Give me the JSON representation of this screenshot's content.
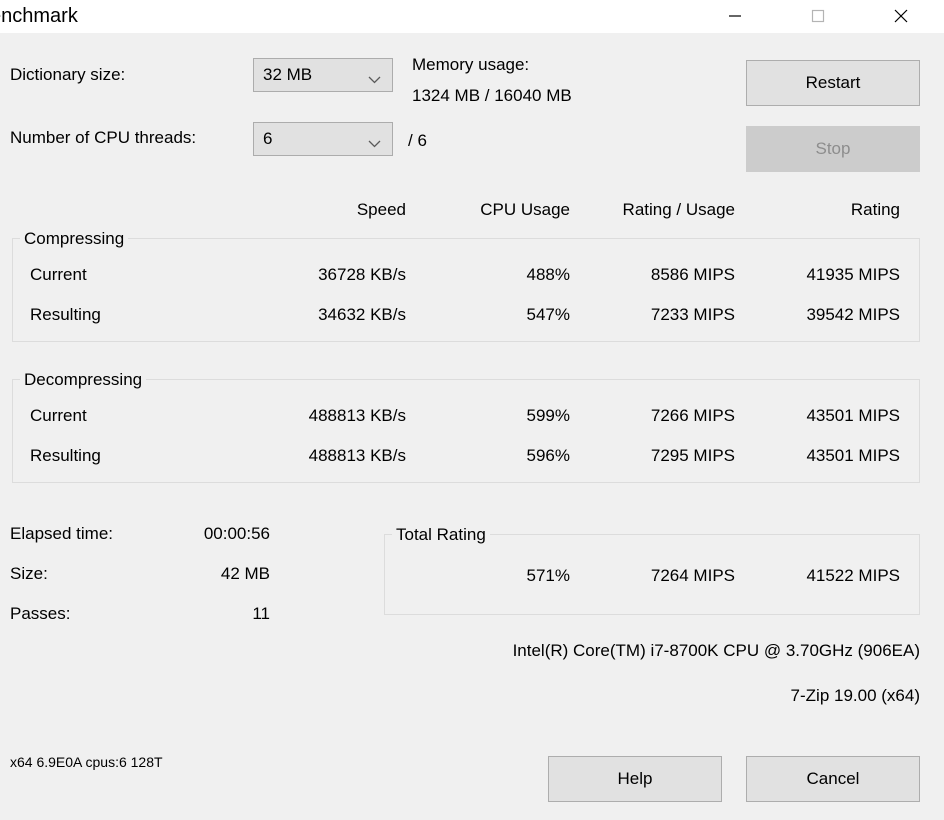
{
  "window": {
    "title": "enchmark",
    "controls": {
      "minimize": "minimize-icon",
      "maximize": "maximize-icon",
      "close": "close-icon"
    }
  },
  "settings": {
    "dictionary_label": "Dictionary size:",
    "dictionary_value": "32 MB",
    "threads_label": "Number of CPU threads:",
    "threads_value": "6",
    "threads_max": "/ 6",
    "memory_label": "Memory usage:",
    "memory_value": "1324 MB / 16040 MB"
  },
  "actions": {
    "restart": "Restart",
    "stop": "Stop",
    "help": "Help",
    "cancel": "Cancel"
  },
  "columns": {
    "speed": "Speed",
    "cpu_usage": "CPU Usage",
    "rating_usage": "Rating / Usage",
    "rating": "Rating"
  },
  "compressing": {
    "title": "Compressing",
    "rows": [
      {
        "label": "Current",
        "speed": "36728 KB/s",
        "cpu_usage": "488%",
        "rating_usage": "8586 MIPS",
        "rating": "41935 MIPS"
      },
      {
        "label": "Resulting",
        "speed": "34632 KB/s",
        "cpu_usage": "547%",
        "rating_usage": "7233 MIPS",
        "rating": "39542 MIPS"
      }
    ]
  },
  "decompressing": {
    "title": "Decompressing",
    "rows": [
      {
        "label": "Current",
        "speed": "488813 KB/s",
        "cpu_usage": "599%",
        "rating_usage": "7266 MIPS",
        "rating": "43501 MIPS"
      },
      {
        "label": "Resulting",
        "speed": "488813 KB/s",
        "cpu_usage": "596%",
        "rating_usage": "7295 MIPS",
        "rating": "43501 MIPS"
      }
    ]
  },
  "stats": {
    "elapsed_label": "Elapsed time:",
    "elapsed_value": "00:00:56",
    "size_label": "Size:",
    "size_value": "42 MB",
    "passes_label": "Passes:",
    "passes_value": "11"
  },
  "total_rating": {
    "title": "Total Rating",
    "cpu_usage": "571%",
    "rating_usage": "7264 MIPS",
    "rating": "41522 MIPS"
  },
  "info": {
    "cpu": "Intel(R) Core(TM) i7-8700K CPU @ 3.70GHz (906EA)",
    "version": "7-Zip 19.00 (x64)",
    "status": "x64 6.9E0A cpus:6 128T"
  }
}
